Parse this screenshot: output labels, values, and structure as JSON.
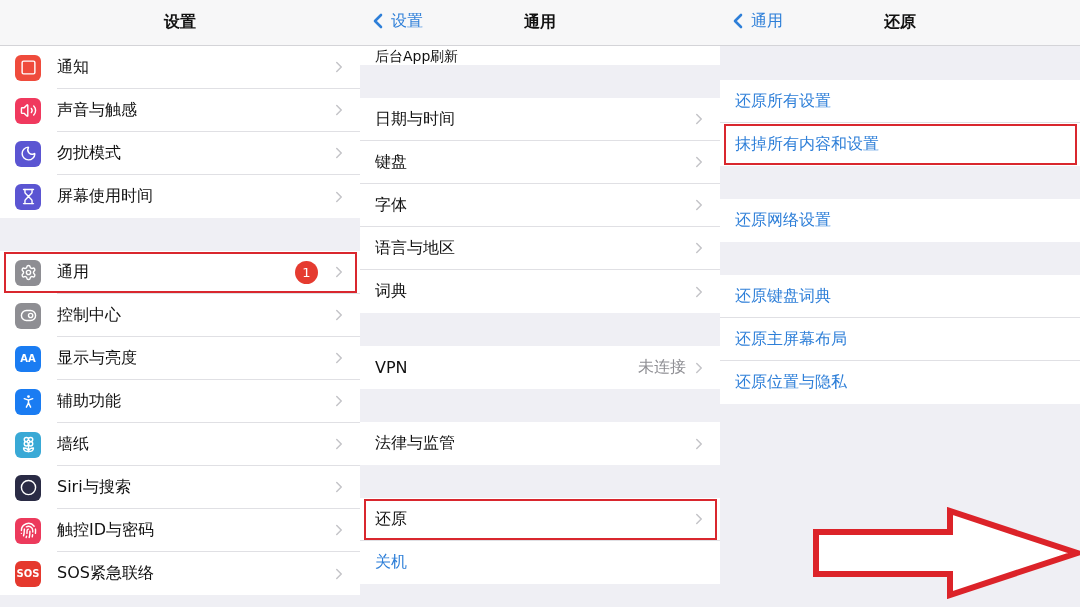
{
  "panels": [
    {
      "nav": {
        "title": "设置"
      },
      "scrolled": true,
      "groups": [
        {
          "rows": [
            {
              "label": "通知",
              "kind": "link",
              "color": "#ef4b3c",
              "highlighted": false
            },
            {
              "label": "声音与触感",
              "kind": "link",
              "color": "#f0395e",
              "highlighted": false
            },
            {
              "label": "勿扰模式",
              "kind": "link",
              "color": "#5b55d2",
              "highlighted": false
            },
            {
              "label": "屏幕使用时间",
              "kind": "link",
              "color": "#5b55d2",
              "highlighted": false
            }
          ]
        },
        {
          "rows": [
            {
              "label": "通用",
              "kind": "link",
              "color": "#8e8e93",
              "badge": "1",
              "highlighted": true
            },
            {
              "label": "控制中心",
              "kind": "link",
              "color": "#8e8e93",
              "highlighted": false
            },
            {
              "label": "显示与亮度",
              "kind": "link",
              "color": "#1a7cf2",
              "icon_text": "AA",
              "highlighted": false
            },
            {
              "label": "辅助功能",
              "kind": "link",
              "color": "#1a7cf2",
              "highlighted": false
            },
            {
              "label": "墙纸",
              "kind": "link",
              "color": "#39a9d6",
              "highlighted": false
            },
            {
              "label": "Siri与搜索",
              "kind": "link",
              "color": "#2a2b45",
              "highlighted": false
            },
            {
              "label": "触控ID与密码",
              "kind": "link",
              "color": "#ec3a5c",
              "highlighted": false
            },
            {
              "label": "SOS紧急联络",
              "kind": "link",
              "color": "#e5392e",
              "icon_text": "SOS",
              "highlighted": false
            }
          ]
        }
      ]
    },
    {
      "nav": {
        "back": "设置",
        "title": "通用"
      },
      "scrolled": true,
      "groups": [
        {
          "rows": [
            {
              "label": "后台App刷新",
              "kind": "partial",
              "highlighted": false
            }
          ]
        },
        {
          "rows": [
            {
              "label": "日期与时间",
              "kind": "link",
              "highlighted": false
            },
            {
              "label": "键盘",
              "kind": "link",
              "highlighted": false
            },
            {
              "label": "字体",
              "kind": "link",
              "highlighted": false
            },
            {
              "label": "语言与地区",
              "kind": "link",
              "highlighted": false
            },
            {
              "label": "词典",
              "kind": "link",
              "highlighted": false
            }
          ]
        },
        {
          "rows": [
            {
              "label": "VPN",
              "kind": "link",
              "value": "未连接",
              "highlighted": false
            }
          ]
        },
        {
          "rows": [
            {
              "label": "法律与监管",
              "kind": "link",
              "highlighted": false
            }
          ]
        },
        {
          "rows": [
            {
              "label": "还原",
              "kind": "link",
              "highlighted": true
            },
            {
              "label": "关机",
              "kind": "action",
              "highlighted": false
            }
          ]
        }
      ]
    },
    {
      "nav": {
        "back": "通用",
        "title": "还原"
      },
      "scrolled": false,
      "groups": [
        {
          "rows": [
            {
              "label": "还原所有设置",
              "kind": "action",
              "highlighted": false
            },
            {
              "label": "抹掉所有内容和设置",
              "kind": "action",
              "highlighted": true
            }
          ]
        },
        {
          "rows": [
            {
              "label": "还原网络设置",
              "kind": "action",
              "highlighted": false
            }
          ]
        },
        {
          "rows": [
            {
              "label": "还原键盘词典",
              "kind": "action",
              "highlighted": false
            },
            {
              "label": "还原主屏幕布局",
              "kind": "action",
              "highlighted": false
            },
            {
              "label": "还原位置与隐私",
              "kind": "action",
              "highlighted": false
            }
          ]
        }
      ]
    }
  ]
}
